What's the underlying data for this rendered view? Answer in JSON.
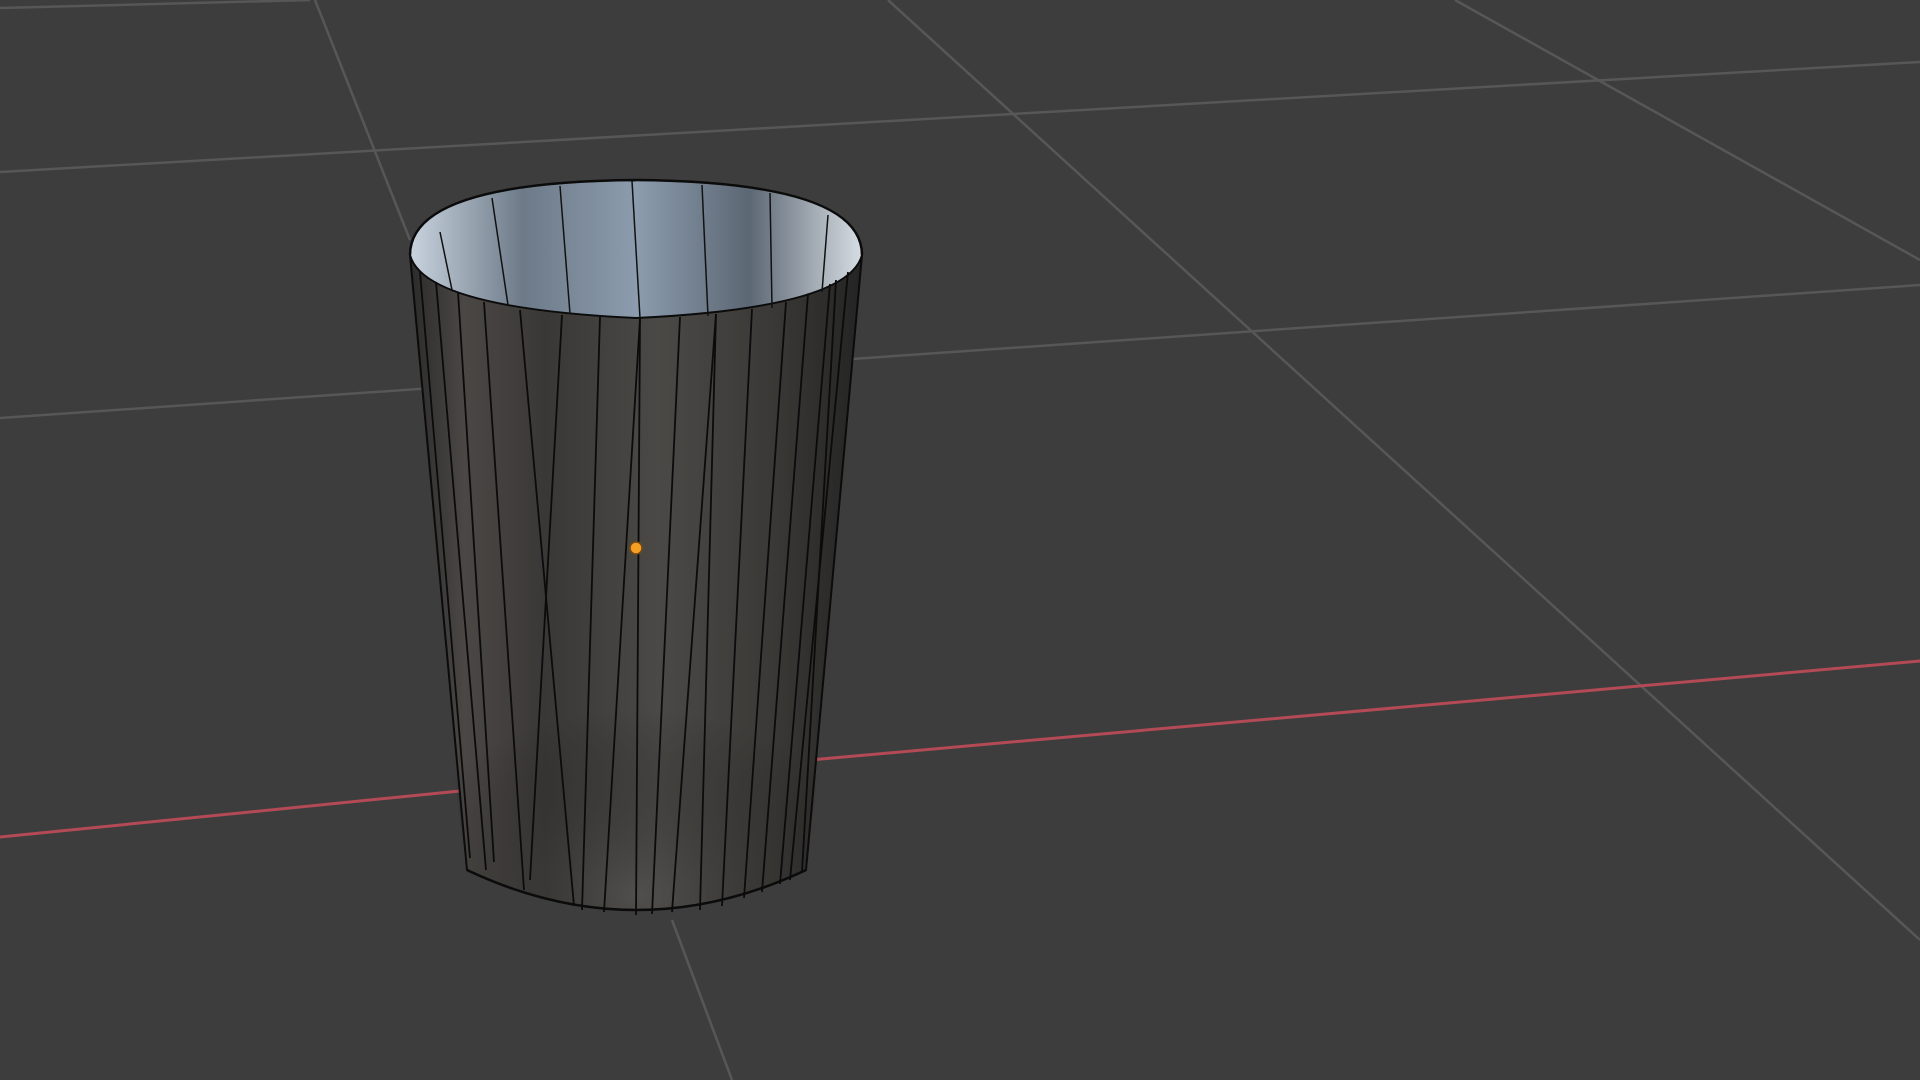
{
  "viewport": {
    "background_color": "#3d3d3d",
    "grid_line_color": "#565656",
    "x_axis_color": "#b34a55",
    "origin_marker_color": "#f5a023",
    "object": {
      "type": "cup-mesh",
      "shading": "material-preview",
      "outer_color": "#2f2f2f",
      "inner_color": "#9fb0c2",
      "edge_color": "#0b0b0b"
    },
    "selected_object_origin_icon": "dot-icon"
  }
}
